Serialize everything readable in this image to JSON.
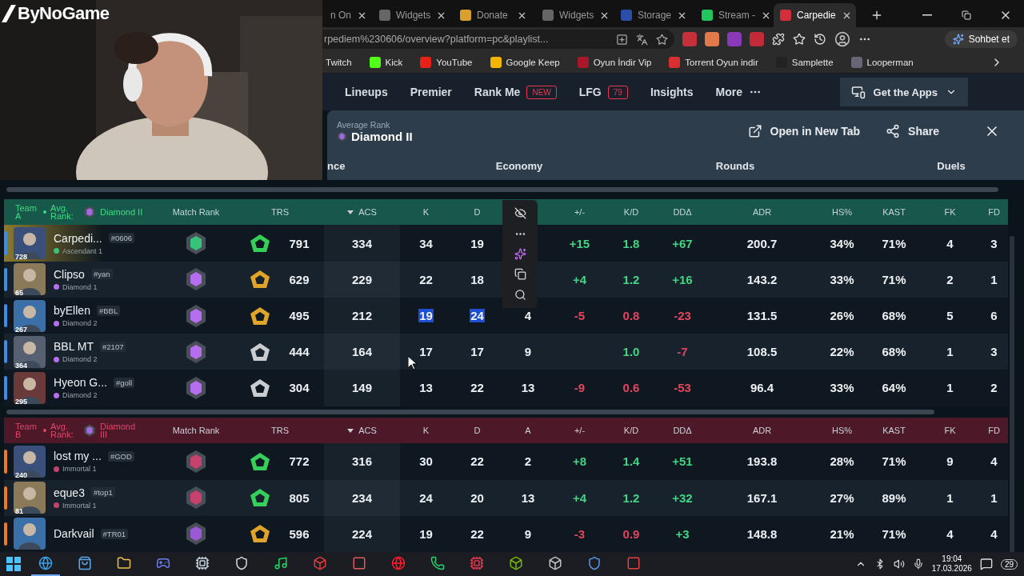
{
  "stream_overlay": {
    "logo": "ByNoGame"
  },
  "browser": {
    "tabs": [
      {
        "title": "n On",
        "selected": false
      },
      {
        "title": "Widgets",
        "selected": false
      },
      {
        "title": "Donate",
        "selected": false
      },
      {
        "title": "Widgets",
        "selected": false
      },
      {
        "title": "Storage",
        "selected": false
      },
      {
        "title": "Stream -",
        "selected": false
      },
      {
        "title": "Carpedie",
        "selected": true
      }
    ],
    "address": "rpediem%230606/overview?platform=pc&playlist...",
    "copilot_button": "Sohbet et",
    "bookmarks": [
      "Twitch",
      "Kick",
      "YouTube",
      "Google Keep",
      "Oyun İndir Vip",
      "Torrent Oyun indir",
      "Samplette",
      "Looperman"
    ]
  },
  "site_nav": {
    "items": [
      {
        "label": "Lineups"
      },
      {
        "label": "Premier"
      },
      {
        "label": "Rank Me",
        "badge": "NEW"
      },
      {
        "label": "LFG",
        "badge": "79"
      },
      {
        "label": "Insights"
      },
      {
        "label": "More"
      }
    ],
    "apps_button": "Get the Apps"
  },
  "modal": {
    "caption": "Average Rank",
    "rank": "Diamond II",
    "open_button": "Open in New Tab",
    "share_button": "Share",
    "sections": [
      "nce",
      "Economy",
      "Rounds",
      "Duels"
    ]
  },
  "teams": [
    {
      "kind": "ally",
      "label": "Team A",
      "avg_label": "Avg. Rank:",
      "avg_rank": "Diamond II",
      "columns": {
        "match_rank": {
          "label": "Match Rank",
          "sorted": false
        },
        "trs": {
          "label": "TRS",
          "sorted": false
        },
        "acs": {
          "label": "ACS",
          "sorted": true
        },
        "k": {
          "label": "K",
          "sorted": false
        },
        "d": {
          "label": "D",
          "sorted": false
        },
        "pm": {
          "label": "+/-",
          "sorted": false
        },
        "kd": {
          "label": "K/D",
          "sorted": false
        },
        "dda": {
          "label": "DDΔ",
          "sorted": false
        },
        "adr": {
          "label": "ADR",
          "sorted": false
        },
        "hs": {
          "label": "HS%",
          "sorted": false
        },
        "kast": {
          "label": "KAST",
          "sorted": false
        },
        "fk": {
          "label": "FK",
          "sorted": false
        },
        "fd": {
          "label": "FD",
          "sorted": false
        }
      },
      "rows": [
        {
          "account_level": "728",
          "name": "Carpedi...",
          "tag": "#0606",
          "rank": "Ascendant 1",
          "color": "#35c47a",
          "featured": true,
          "stats": {
            "trs": {
              "value": "791",
              "color": "#35d05a"
            },
            "acs": "334",
            "k": "34",
            "d": "19",
            "pm": {
              "value": "+15",
              "color": "#45d483"
            },
            "kd": {
              "value": "1.8",
              "color": "#45d483"
            },
            "dda": {
              "value": "+67",
              "color": "#45d483"
            },
            "adr": "200.7",
            "hs": "34%",
            "kast": "71%",
            "fk": "4",
            "fd": "3"
          }
        },
        {
          "account_level": "65",
          "name": "Clipso",
          "tag": "#yan",
          "rank": "Diamond 1",
          "color": "#b56ef0",
          "featured": false,
          "stats": {
            "trs": {
              "value": "629",
              "color": "#e0a528"
            },
            "acs": "229",
            "k": "22",
            "d": "18",
            "pm": {
              "value": "+4",
              "color": "#45d483"
            },
            "kd": {
              "value": "1.2",
              "color": "#45d483"
            },
            "dda": {
              "value": "+16",
              "color": "#45d483"
            },
            "adr": "143.2",
            "hs": "33%",
            "kast": "71%",
            "fk": "2",
            "fd": "1"
          }
        },
        {
          "account_level": "267",
          "name": "byEllen",
          "tag": "#BBL",
          "rank": "Diamond 2",
          "color": "#b56ef0",
          "featured": false,
          "stats": {
            "trs": {
              "value": "495",
              "color": "#e0a528"
            },
            "acs": "212",
            "k": {
              "value": "19",
              "selected": true
            },
            "d": {
              "value": "24",
              "selected": true
            },
            "a": "4",
            "pm": {
              "value": "-5",
              "color": "#e0465e"
            },
            "kd": {
              "value": "0.8",
              "color": "#e0465e"
            },
            "dda": {
              "value": "-23",
              "color": "#e0465e"
            },
            "adr": "131.5",
            "hs": "26%",
            "kast": "68%",
            "fk": "5",
            "fd": "6"
          }
        },
        {
          "account_level": "364",
          "name": "BBL MT",
          "tag": "#2107",
          "rank": "Diamond 2",
          "color": "#b56ef0",
          "featured": false,
          "stats": {
            "trs": {
              "value": "444",
              "color": "#c9ccd1"
            },
            "acs": "164",
            "k": "17",
            "d": "17",
            "a": "9",
            "kd": {
              "value": "1.0",
              "color": "#45d483"
            },
            "dda": {
              "value": "-7",
              "color": "#e0465e"
            },
            "adr": "108.5",
            "hs": "22%",
            "kast": "68%",
            "fk": "1",
            "fd": "3"
          }
        },
        {
          "account_level": "295",
          "name": "Hyeon G...",
          "tag": "#goll",
          "rank": "Diamond 2",
          "color": "#b56ef0",
          "featured": false,
          "stats": {
            "trs": {
              "value": "304",
              "color": "#c9ccd1"
            },
            "acs": "149",
            "k": "13",
            "d": "22",
            "a": "13",
            "pm": {
              "value": "-9",
              "color": "#e0465e"
            },
            "kd": {
              "value": "0.6",
              "color": "#e0465e"
            },
            "dda": {
              "value": "-53",
              "color": "#e0465e"
            },
            "adr": "96.4",
            "hs": "33%",
            "kast": "64%",
            "fk": "1",
            "fd": "2"
          }
        }
      ]
    },
    {
      "kind": "enemy",
      "label": "Team B",
      "avg_label": "Avg. Rank:",
      "avg_rank": "Diamond III",
      "columns": {
        "match_rank": {
          "label": "Match Rank",
          "sorted": false
        },
        "trs": {
          "label": "TRS",
          "sorted": false
        },
        "acs": {
          "label": "ACS",
          "sorted": true
        },
        "k": {
          "label": "K",
          "sorted": false
        },
        "d": {
          "label": "D",
          "sorted": false
        },
        "a": {
          "label": "A",
          "sorted": false
        },
        "pm": {
          "label": "+/-",
          "sorted": false
        },
        "kd": {
          "label": "K/D",
          "sorted": false
        },
        "dda": {
          "label": "DDΔ",
          "sorted": false
        },
        "adr": {
          "label": "ADR",
          "sorted": false
        },
        "hs": {
          "label": "HS%",
          "sorted": false
        },
        "kast": {
          "label": "KAST",
          "sorted": false
        },
        "fk": {
          "label": "FK",
          "sorted": false
        },
        "fd": {
          "label": "FD",
          "sorted": false
        }
      },
      "rows": [
        {
          "account_level": "240",
          "name": "lost my ...",
          "tag": "#GOD",
          "rank": "Immortal 1",
          "color": "#c8406c",
          "featured": false,
          "stats": {
            "trs": {
              "value": "772",
              "color": "#35d05a"
            },
            "acs": "316",
            "k": "30",
            "d": "22",
            "a": "2",
            "pm": {
              "value": "+8",
              "color": "#45d483"
            },
            "kd": {
              "value": "1.4",
              "color": "#45d483"
            },
            "dda": {
              "value": "+51",
              "color": "#45d483"
            },
            "adr": "193.8",
            "hs": "28%",
            "kast": "71%",
            "fk": "9",
            "fd": "4"
          }
        },
        {
          "account_level": "81",
          "name": "eque3",
          "tag": "#top1",
          "rank": "Immortal 1",
          "color": "#c8406c",
          "featured": false,
          "stats": {
            "trs": {
              "value": "805",
              "color": "#35d05a"
            },
            "acs": "234",
            "k": "24",
            "d": "20",
            "a": "13",
            "pm": {
              "value": "+4",
              "color": "#45d483"
            },
            "kd": {
              "value": "1.2",
              "color": "#45d483"
            },
            "dda": {
              "value": "+32",
              "color": "#45d483"
            },
            "adr": "167.1",
            "hs": "27%",
            "kast": "89%",
            "fk": "1",
            "fd": "1"
          }
        },
        {
          "name": "Darkvail",
          "tag": "#TR01",
          "color": "#9a5ad8",
          "featured": false,
          "stats": {
            "trs": {
              "value": "596",
              "color": "#e0a528"
            },
            "acs": "224",
            "k": "19",
            "d": "22",
            "a": "9",
            "pm": {
              "value": "-3",
              "color": "#e0465e"
            },
            "kd": {
              "value": "0.9",
              "color": "#e0465e"
            },
            "dda": {
              "value": "+3",
              "color": "#45d483"
            },
            "adr": "148.8",
            "hs": "21%",
            "kast": "71%",
            "fk": "4",
            "fd": "4"
          }
        }
      ]
    }
  ],
  "taskbar": {
    "time": "19:04",
    "date": "17.03.2026",
    "notifications": "29"
  }
}
